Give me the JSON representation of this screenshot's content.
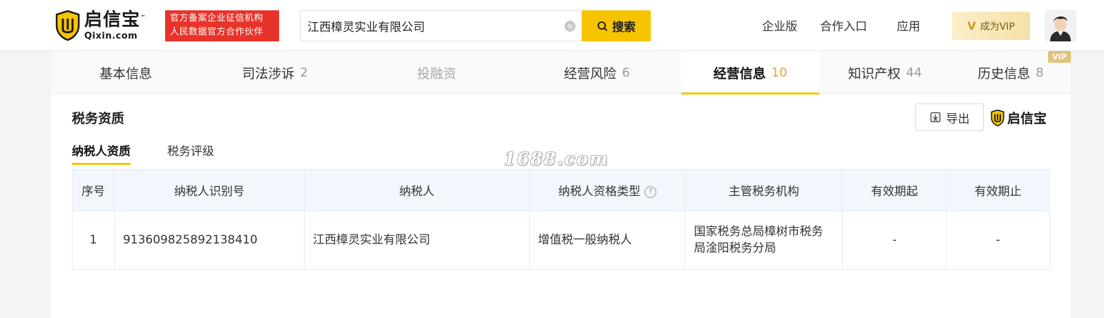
{
  "brand": {
    "logo_cn": "启信宝",
    "logo_en": "Qixin.com",
    "tm": "™",
    "badge_line1": "官方备案企业征信机构",
    "badge_line2": "人民数据官方合作伙伴",
    "primary_color": "#f7c400",
    "badge_color": "#e8332a"
  },
  "search": {
    "value": "江西樟灵实业有限公司",
    "button_label": "搜索",
    "clear_icon": "clear-icon"
  },
  "nav": {
    "enterprise": "企业版",
    "partner": "合作入口",
    "apps": "应用",
    "vip": "成为VIP",
    "vip_mark": "V"
  },
  "tabs": [
    {
      "label": "基本信息",
      "count": ""
    },
    {
      "label": "司法涉诉",
      "count": "2"
    },
    {
      "label": "投融资",
      "count": ""
    },
    {
      "label": "经营风险",
      "count": "6"
    },
    {
      "label": "经营信息",
      "count": "10"
    },
    {
      "label": "知识产权",
      "count": "44"
    },
    {
      "label": "历史信息",
      "count": "8"
    }
  ],
  "vip_tag": "VIP",
  "section": {
    "title": "税务资质",
    "export_label": "导出",
    "logo_cn": "启信宝",
    "subtabs": [
      "纳税人资质",
      "税务评级"
    ]
  },
  "watermark": "1688.com",
  "table": {
    "headers": [
      "序号",
      "纳税人识别号",
      "纳税人",
      "纳税人资格类型",
      "主管税务机构",
      "有效期起",
      "有效期止"
    ],
    "help_mark": "?",
    "rows": [
      {
        "no": "1",
        "tax_id": "913609825892138410",
        "taxpayer": "江西樟灵实业有限公司",
        "type": "增值税一般纳税人",
        "authority": "国家税务总局樟树市税务局淦阳税务分局",
        "valid_from": "-",
        "valid_to": "-"
      }
    ]
  }
}
